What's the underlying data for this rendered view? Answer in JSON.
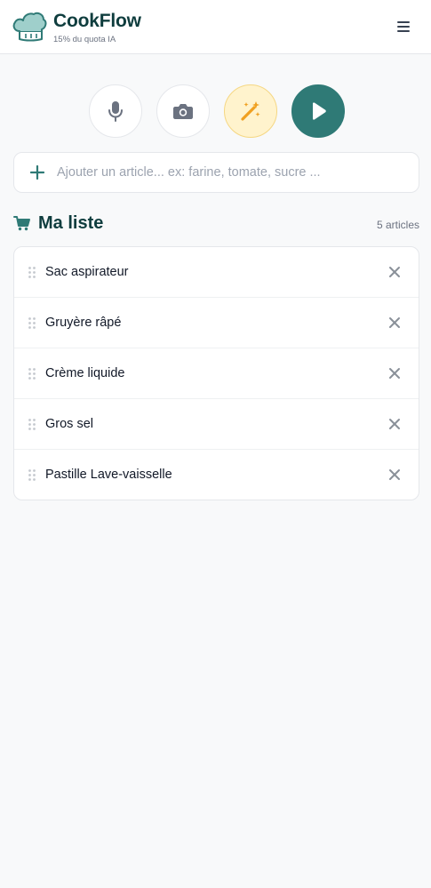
{
  "app": {
    "title": "CookFlow",
    "quota": "15% du quota IA"
  },
  "colors": {
    "primary": "#2f7a76",
    "dark": "#0f3d3e",
    "magic_bg": "#fff3cd",
    "magic_icon": "#f0a020"
  },
  "actions": {
    "mic_icon": "microphone-icon",
    "camera_icon": "camera-icon",
    "magic_icon": "magic-wand-icon",
    "play_icon": "play-icon"
  },
  "add": {
    "placeholder": "Ajouter un article... ex: farine, tomate, sucre ..."
  },
  "list": {
    "title": "Ma liste",
    "count": "5 articles",
    "items": [
      {
        "label": "Sac aspirateur"
      },
      {
        "label": "Gruyère râpé"
      },
      {
        "label": "Crème liquide"
      },
      {
        "label": "Gros sel"
      },
      {
        "label": "Pastille Lave-vaisselle"
      }
    ]
  }
}
